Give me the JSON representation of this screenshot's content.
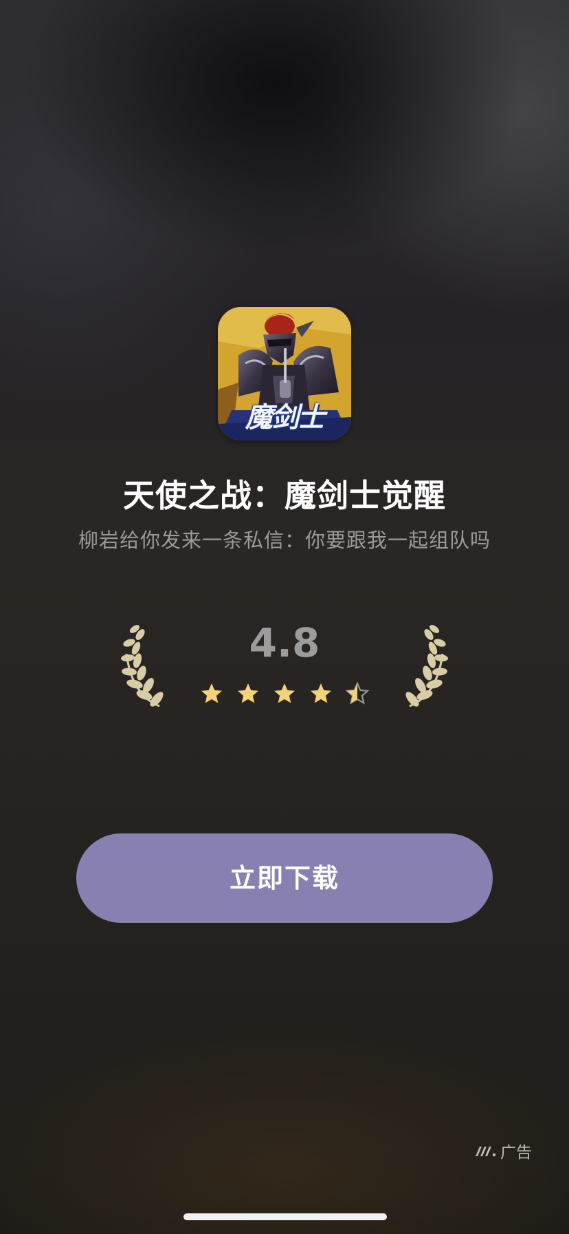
{
  "app": {
    "icon_caption": "魔剑士",
    "title": "天使之战：魔剑士觉醒",
    "message": "柳岩给你发来一条私信：你要跟我一起组队吗"
  },
  "rating": {
    "value": "4.8",
    "stars_filled": 4.5,
    "stars_total": 5,
    "star_color": "#f3d27a",
    "laurel_color": "#d8cda6"
  },
  "download_button": {
    "label": "立即下载",
    "color": "#8880b0"
  },
  "ad_badge": {
    "icon": "ad-brand-stripes-icon",
    "label": "广告"
  },
  "home_indicator": {
    "icon": "home-indicator-bar"
  }
}
